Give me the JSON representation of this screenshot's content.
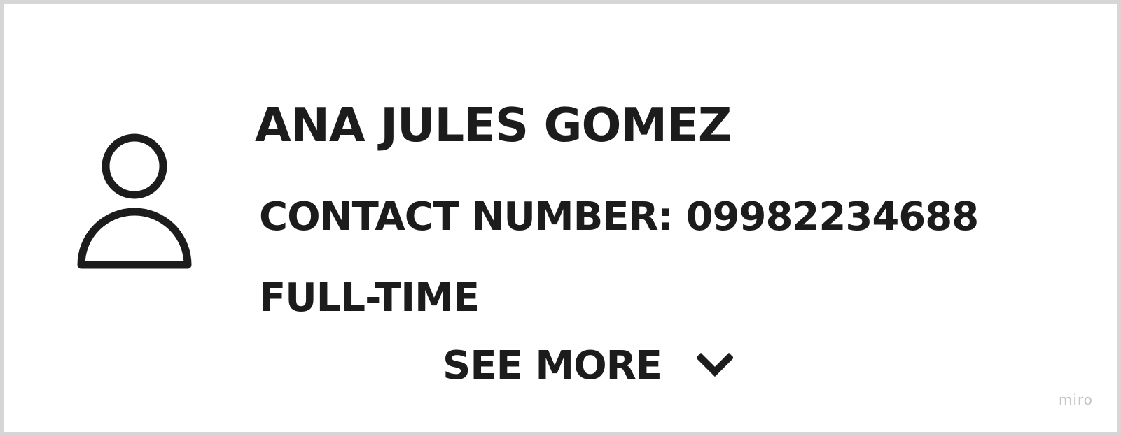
{
  "card": {
    "avatar_icon": "user-icon",
    "name": "ANA JULES GOMEZ",
    "contact": "CONTACT NUMBER: 09982234688",
    "employment_type": "FULL-TIME",
    "see_more_label": "SEE MORE",
    "see_more_icon": "chevron-down-icon"
  },
  "watermark": "miro",
  "colors": {
    "text": "#1c1c1c",
    "border": "#d6d6d6",
    "watermark": "#c4c4c8",
    "background": "#ffffff"
  }
}
